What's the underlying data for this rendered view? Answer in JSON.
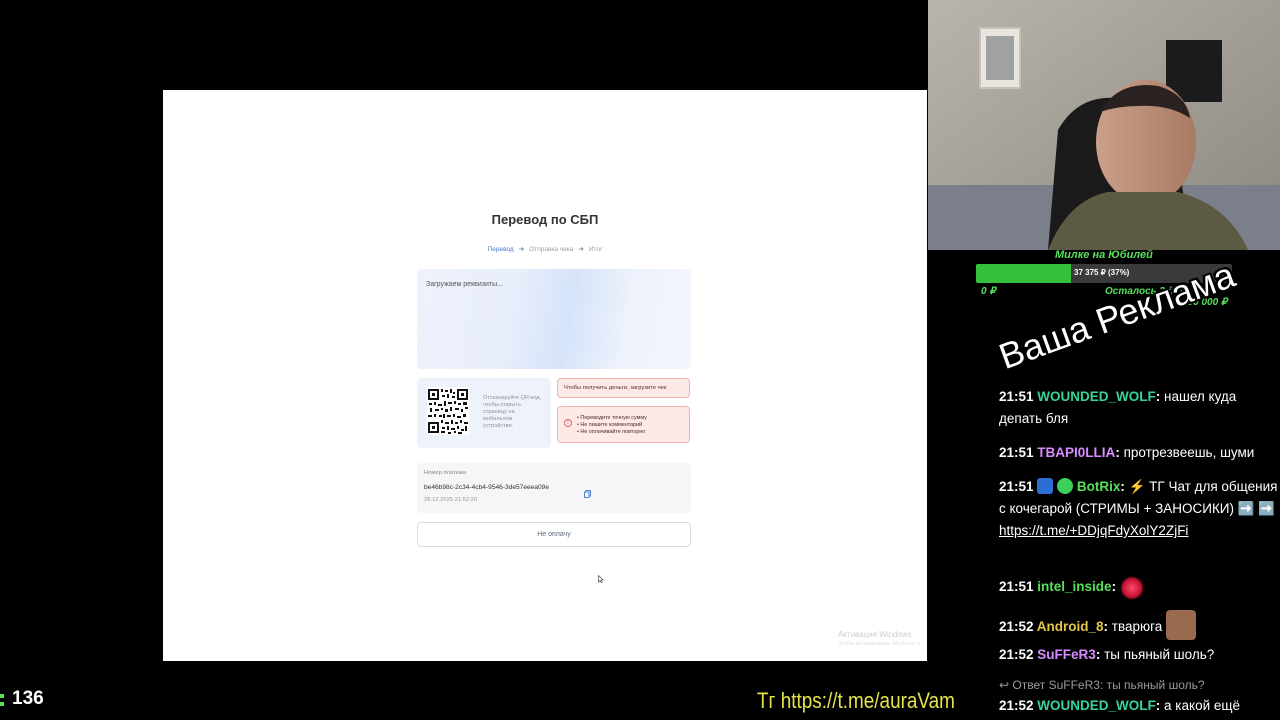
{
  "page": {
    "title": "Перевод по СБП",
    "steps": [
      "Перевод",
      "Отправка чека",
      "Итог"
    ],
    "loading_text": "Загружаем реквизиты...",
    "qr_text": "Отсканируйте QR-код, чтобы открыть страницу на мобильном устройстве.",
    "upload_banner": "Чтобы получить деньги, загрузите чек",
    "warnings": [
      "Переводите точную сумму",
      "Не пишите комментарий",
      "Не оплачивайте повторно"
    ],
    "payment_label": "Номер платежа",
    "payment_id": "be46b98c-2c34-4cb4-9546-3de57eeea09e",
    "payment_time": "28.12.2025 21:52:20",
    "no_pay_button": "Не оплачу",
    "windows_activation": "Активация Windows",
    "windows_activation_sub": "Чтобы активировать Windows, п"
  },
  "goal": {
    "title": "Милке на Юбилей",
    "amount": "37 375 ₽ (37%)",
    "progress": 0.37,
    "min": "0 ₽",
    "remaining": "Осталось 2 дня",
    "max": "100 000 ₽"
  },
  "ad_text": "Ваша Реклама",
  "chat": [
    {
      "time": "21:51",
      "user": "WOUNDED_WOLF",
      "user_color": "#39d39a",
      "text": "нашел куда депать бля"
    },
    {
      "time": "21:51",
      "user": "TBAPI0LLIA",
      "user_color": "#d98cff",
      "text": "протрезвеешь, шуми"
    },
    {
      "time": "21:51",
      "user": "BotRix",
      "user_color": "#56e05a",
      "text": "⚡ ТГ Чат для общения с кочегарой (СТРИМЫ + ЗАНОСИКИ) ➡️ ➡️",
      "link": "https://t.me/+DDjqFdyXolY2ZjFi"
    },
    {
      "time": "21:51",
      "user": "intel_inside",
      "user_color": "#56e05a",
      "text": ""
    },
    {
      "time": "21:52",
      "user": "Android_8",
      "user_color": "#e2c74a",
      "text": "тварюга"
    },
    {
      "time": "21:52",
      "user": "SuFFeR3",
      "user_color": "#d98cff",
      "text": "ты пьяный шоль?"
    },
    {
      "time": "21:52",
      "user": "WOUNDED_WOLF",
      "user_color": "#39d39a",
      "text": "а какой ещё"
    }
  ],
  "reply_line": "Ответ SuFFeR3: ты пьяный шоль?",
  "viewer_count": "136",
  "tg_link": "Тг https://t.me/auraVam"
}
